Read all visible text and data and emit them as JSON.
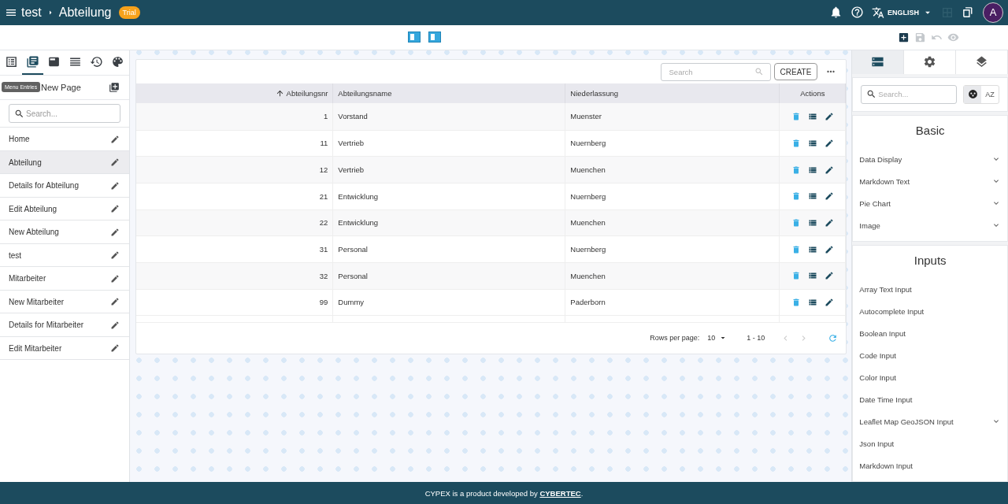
{
  "header": {
    "breadcrumb": [
      "test",
      "Abteilung"
    ],
    "badge": "Trial",
    "language": "ENGLISH",
    "avatar": "A"
  },
  "toolbar": {
    "actions": [
      {
        "kind": "add",
        "disabled": false
      },
      {
        "kind": "save",
        "disabled": true
      },
      {
        "kind": "undo",
        "disabled": true
      },
      {
        "kind": "preview",
        "disabled": true
      }
    ]
  },
  "sidebar": {
    "tabs": [
      {
        "kind": "pages",
        "selected": false
      },
      {
        "kind": "menu",
        "selected": true
      },
      {
        "kind": "header",
        "selected": false
      },
      {
        "kind": "lines",
        "selected": false
      },
      {
        "kind": "history",
        "selected": false
      },
      {
        "kind": "theme",
        "selected": false
      }
    ],
    "tooltip": "Menu Entries",
    "new_page": "New Page",
    "search": {
      "placeholder": "Search..."
    },
    "items": [
      {
        "label": "Home",
        "selected": false
      },
      {
        "label": "Abteilung",
        "selected": true
      },
      {
        "label": "Details for Abteilung",
        "selected": false
      },
      {
        "label": "Edit Abteilung",
        "selected": false
      },
      {
        "label": "New Abteilung",
        "selected": false
      },
      {
        "label": "test",
        "selected": false
      },
      {
        "label": "Mitarbeiter",
        "selected": false
      },
      {
        "label": "New Mitarbeiter",
        "selected": false
      },
      {
        "label": "Details for Mitarbeiter",
        "selected": false
      },
      {
        "label": "Edit Mitarbeiter",
        "selected": false
      }
    ]
  },
  "table": {
    "search": {
      "placeholder": "Search"
    },
    "create": "CREATE",
    "columns": [
      {
        "label": "Abteilungsnr",
        "sorted": true
      },
      {
        "label": "Abteilungsname",
        "sorted": false
      },
      {
        "label": "Niederlassung",
        "sorted": false
      },
      {
        "label": "Actions",
        "sorted": false
      }
    ],
    "rows": [
      [
        "1",
        "Vorstand",
        "Muenster"
      ],
      [
        "11",
        "Vertrieb",
        "Nuernberg"
      ],
      [
        "12",
        "Vertrieb",
        "Muenchen"
      ],
      [
        "21",
        "Entwicklung",
        "Nuernberg"
      ],
      [
        "22",
        "Entwicklung",
        "Muenchen"
      ],
      [
        "31",
        "Personal",
        "Nuernberg"
      ],
      [
        "32",
        "Personal",
        "Muenchen"
      ],
      [
        "99",
        "Dummy",
        "Paderborn"
      ]
    ],
    "pagination": {
      "rows_per_page_label": "Rows per page:",
      "rows_per_page": "10",
      "range": "1 - 10"
    }
  },
  "panel": {
    "tabs": [
      {
        "kind": "components",
        "selected": true
      },
      {
        "kind": "settings",
        "selected": false
      },
      {
        "kind": "layers",
        "selected": false
      }
    ],
    "search": {
      "placeholder": "Search..."
    },
    "view_toggle": [
      {
        "kind": "groups",
        "selected": true
      },
      {
        "kind": "alphabetical",
        "label": "AZ",
        "selected": false
      }
    ],
    "sections": [
      {
        "title": "Basic",
        "items": [
          {
            "label": "Data Display",
            "expandable": true
          },
          {
            "label": "Markdown Text",
            "expandable": true
          },
          {
            "label": "Pie Chart",
            "expandable": true
          },
          {
            "label": "Image",
            "expandable": true
          }
        ]
      },
      {
        "title": "Inputs",
        "items": [
          {
            "label": "Array Text Input",
            "expandable": false
          },
          {
            "label": "Autocomplete Input",
            "expandable": false
          },
          {
            "label": "Boolean Input",
            "expandable": false
          },
          {
            "label": "Code Input",
            "expandable": false
          },
          {
            "label": "Color Input",
            "expandable": false
          },
          {
            "label": "Date Time Input",
            "expandable": false
          },
          {
            "label": "Leaflet Map GeoJSON Input",
            "expandable": true
          },
          {
            "label": "Json Input",
            "expandable": false
          },
          {
            "label": "Markdown Input",
            "expandable": false
          }
        ]
      }
    ]
  },
  "footer": {
    "text": "CYPEX is a product developed by ",
    "link": "CYBERTEC",
    "end": "."
  }
}
